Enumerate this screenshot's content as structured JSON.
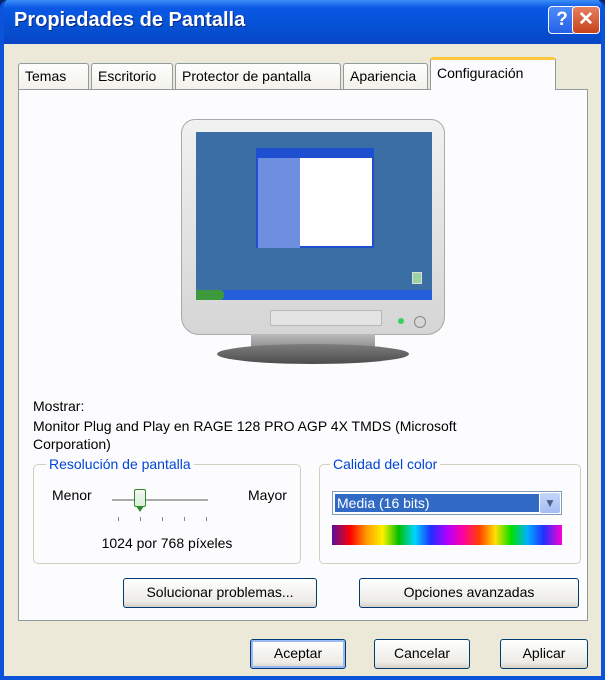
{
  "window": {
    "title": "Propiedades de Pantalla",
    "help_glyph": "?",
    "close_glyph": "✕"
  },
  "tabs": [
    {
      "label": "Temas"
    },
    {
      "label": "Escritorio"
    },
    {
      "label": "Protector de pantalla"
    },
    {
      "label": "Apariencia"
    },
    {
      "label": "Configuración",
      "active": true
    }
  ],
  "display": {
    "label": "Mostrar:",
    "device": "Monitor Plug and Play en RAGE 128 PRO AGP 4X TMDS (Microsoft",
    "device_cont": "Corporation)"
  },
  "resolution": {
    "legend": "Resolución de pantalla",
    "min_label": "Menor",
    "max_label": "Mayor",
    "value_text": "1024 por 768 píxeles",
    "slider_position": 0.33
  },
  "color_quality": {
    "legend": "Calidad del color",
    "selected": "Media (16 bits)"
  },
  "buttons": {
    "troubleshoot": "Solucionar problemas...",
    "advanced": "Opciones avanzadas",
    "ok": "Aceptar",
    "cancel": "Cancelar",
    "apply": "Aplicar"
  },
  "colors": {
    "titlebar": "#0551d4",
    "selection": "#316ac5",
    "group_legend": "#0046d5",
    "active_tab_highlight": "#ffc83c"
  }
}
